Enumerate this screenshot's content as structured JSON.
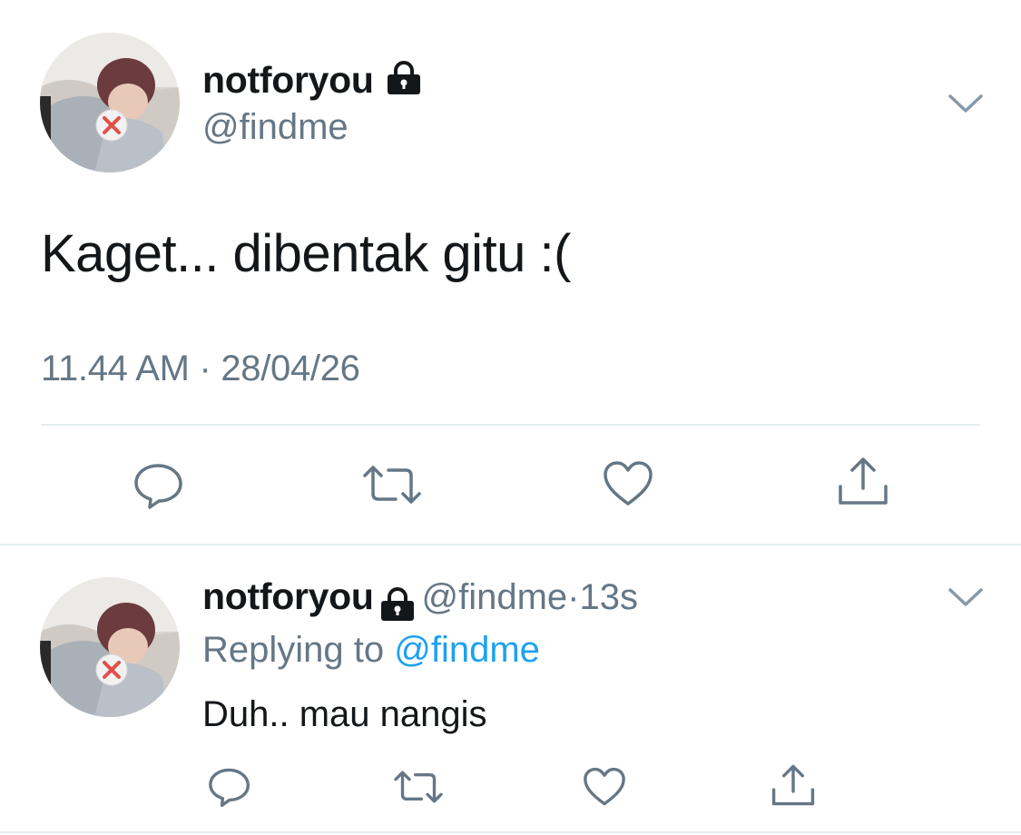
{
  "main_tweet": {
    "display_name": "notforyou",
    "handle": "@findme",
    "text": "Kaget... dibentak gitu :(",
    "time": "11.44 AM",
    "separator": "·",
    "date": "28/04/26",
    "avatar_icon": "profile-photo",
    "lock_icon": "lock-icon",
    "menu_icon": "chevron-down-icon"
  },
  "actions": [
    "reply-icon",
    "retweet-icon",
    "like-icon",
    "share-icon"
  ],
  "reply_tweet": {
    "display_name": "notforyou",
    "handle": "@findme",
    "dot": "·",
    "age": "13s",
    "replying_prefix": "Replying to",
    "replying_handle": "@findme",
    "text": "Duh.. mau nangis"
  },
  "colors": {
    "text": "#14171a",
    "secondary": "#657786",
    "link": "#1da1f2",
    "divider": "#e6ecf0"
  }
}
